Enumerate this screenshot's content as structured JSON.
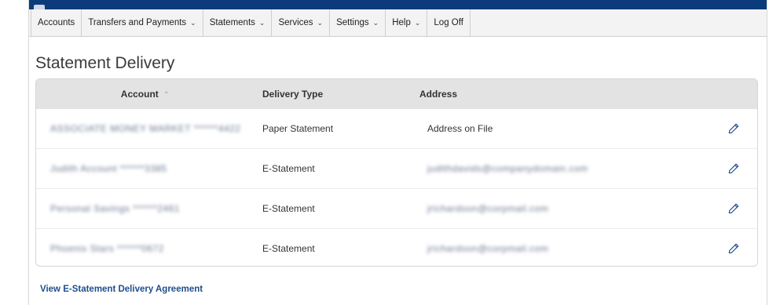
{
  "nav": {
    "items": [
      {
        "label": "Accounts",
        "has_menu": false
      },
      {
        "label": "Transfers and Payments",
        "has_menu": true
      },
      {
        "label": "Statements",
        "has_menu": true
      },
      {
        "label": "Services",
        "has_menu": true
      },
      {
        "label": "Settings",
        "has_menu": true
      },
      {
        "label": "Help",
        "has_menu": true
      },
      {
        "label": "Log Off",
        "has_menu": false
      }
    ],
    "chevron": "chevron-down-icon"
  },
  "page": {
    "title": "Statement Delivery"
  },
  "table": {
    "headers": {
      "account": "Account",
      "delivery_type": "Delivery Type",
      "address": "Address"
    },
    "rows": [
      {
        "account": "ASSOCIATE MONEY MARKET ******4422",
        "delivery_type": "Paper Statement",
        "address": "Address on File"
      },
      {
        "account": "Judith Account ******3385",
        "delivery_type": "E-Statement",
        "address": "judithdavids@companydomain.com"
      },
      {
        "account": "Personal Savings ******2461",
        "delivery_type": "E-Statement",
        "address": "jrichardson@corpmail.com"
      },
      {
        "account": "Phoenix Stars ******0672",
        "delivery_type": "E-Statement",
        "address": "jrichardson@corpmail.com"
      }
    ]
  },
  "footer": {
    "link": "View E-Statement Delivery Agreement"
  },
  "colors": {
    "brand_bar": "#0b3b7a",
    "link": "#1f4e8c",
    "header_bg": "#e3e3e3",
    "edit_icon": "#1f4e8c"
  }
}
